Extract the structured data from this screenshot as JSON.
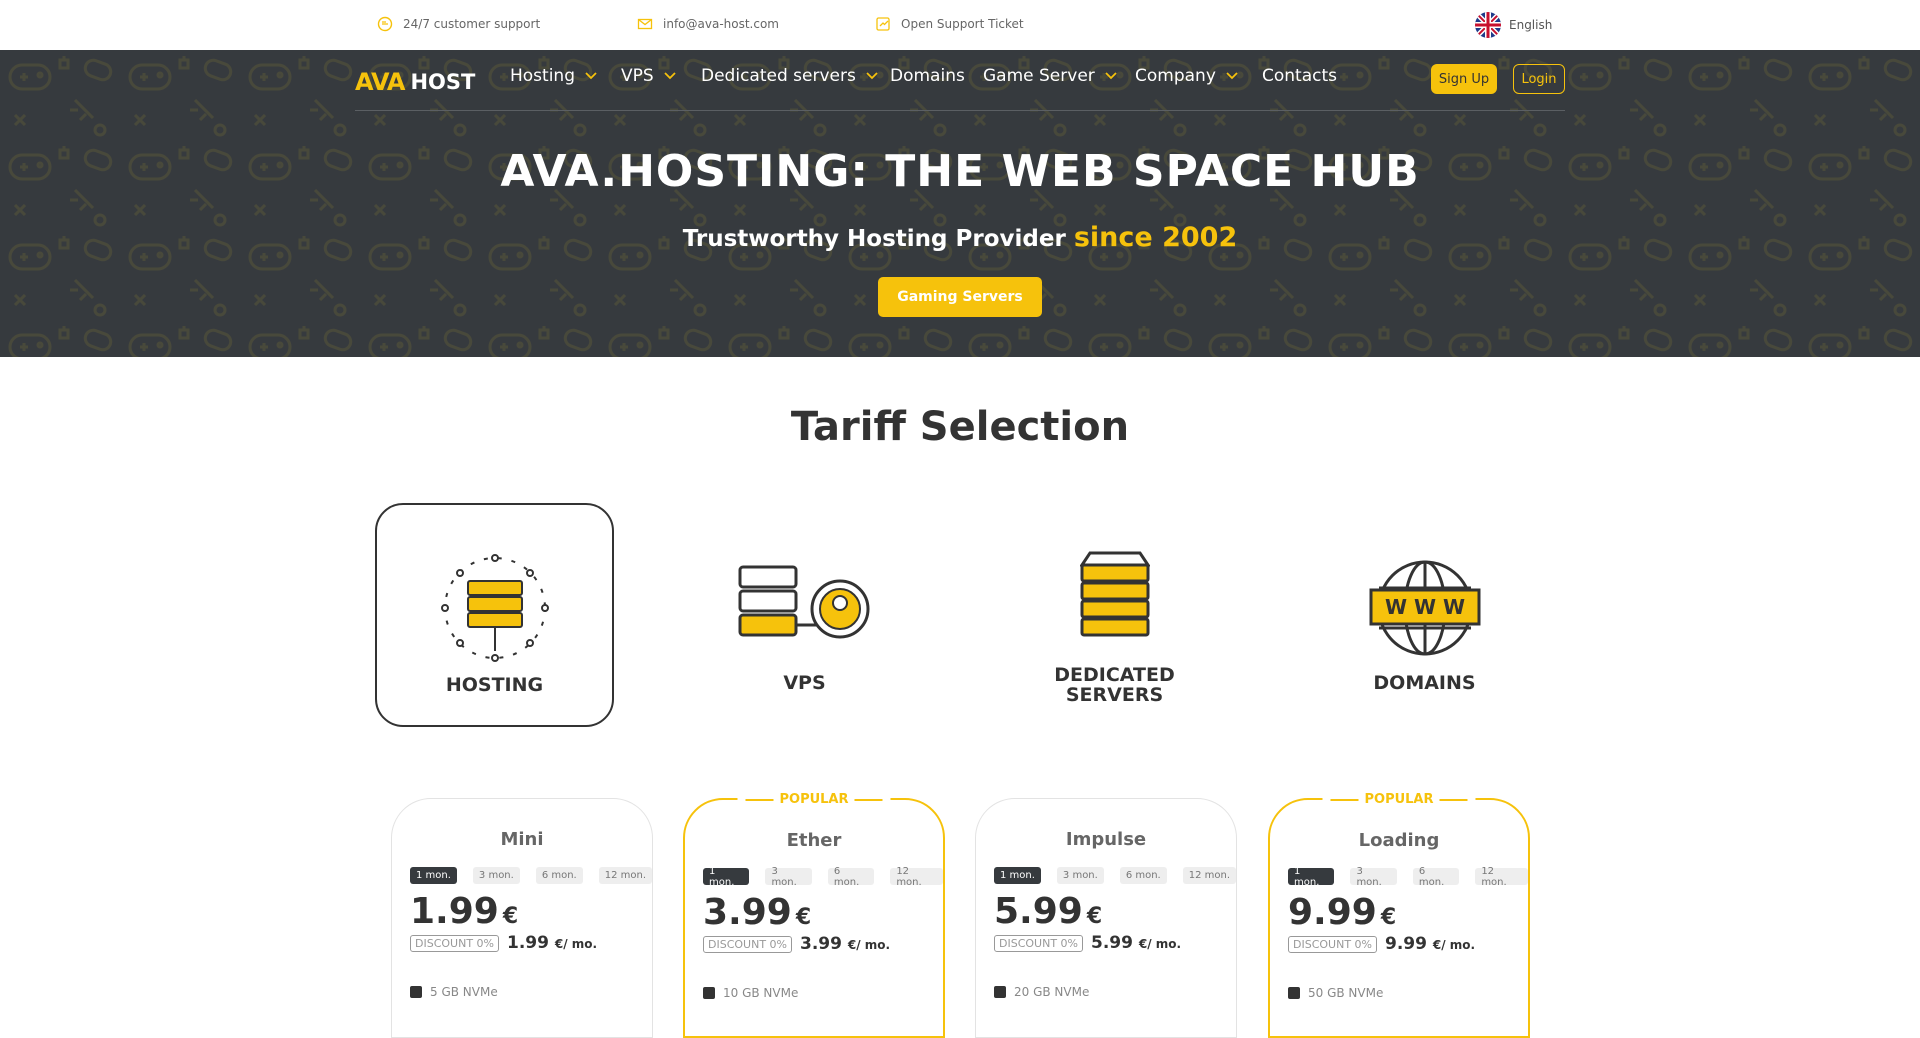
{
  "topbar": {
    "support": "24/7 customer support",
    "email": "info@ava-host.com",
    "ticket": "Open Support Ticket",
    "language": "English"
  },
  "nav": {
    "logo_ava": "AVA",
    "logo_host": "HOST",
    "items": [
      {
        "label": "Hosting"
      },
      {
        "label": "VPS"
      },
      {
        "label": "Dedicated servers"
      },
      {
        "label": "Domains"
      },
      {
        "label": "Game Server"
      },
      {
        "label": "Company"
      },
      {
        "label": "Contacts"
      }
    ],
    "signup": "Sign Up",
    "login": "Login"
  },
  "hero": {
    "title": "AVA.HOSTING: THE WEB SPACE HUB",
    "subtitle": "Trustworthy Hosting Provider",
    "subtitle_accent": "since 2002",
    "cta": "Gaming Servers"
  },
  "tariff": {
    "title": "Tariff Selection",
    "categories": [
      {
        "label": "HOSTING",
        "icon": "hosting-icon",
        "active": true
      },
      {
        "label": "VPS",
        "icon": "vps-icon"
      },
      {
        "label_line1": "DEDICATED",
        "label_line2": "SERVERS",
        "icon": "dedicated-servers-icon"
      },
      {
        "label": "DOMAINS",
        "icon": "domains-icon"
      }
    ]
  },
  "plans": [
    {
      "name": "Mini",
      "popular": false,
      "price": "1.99",
      "currency": "€",
      "discount": "DISCOUNT 0%",
      "per_month": "1.99",
      "per_unit": "€/ mo.",
      "feature": "5 GB NVMe"
    },
    {
      "name": "Ether",
      "popular": true,
      "popular_label": "POPULAR",
      "price": "3.99",
      "currency": "€",
      "discount": "DISCOUNT 0%",
      "per_month": "3.99",
      "per_unit": "€/ mo.",
      "feature": "10 GB NVMe"
    },
    {
      "name": "Impulse",
      "popular": false,
      "price": "5.99",
      "currency": "€",
      "discount": "DISCOUNT 0%",
      "per_month": "5.99",
      "per_unit": "€/ mo.",
      "feature": "20 GB NVMe"
    },
    {
      "name": "Loading",
      "popular": true,
      "popular_label": "POPULAR",
      "price": "9.99",
      "currency": "€",
      "discount": "DISCOUNT 0%",
      "per_month": "9.99",
      "per_unit": "€/ mo.",
      "feature": "50 GB NVMe"
    }
  ],
  "periods": [
    "1 mon.",
    "3 mon.",
    "6 mon.",
    "12 mon."
  ],
  "colors": {
    "accent": "#f6c20c",
    "dark": "#363a3e"
  }
}
